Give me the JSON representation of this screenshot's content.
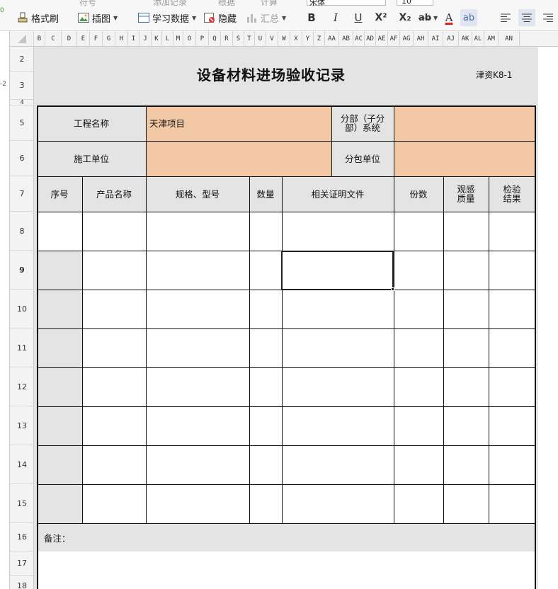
{
  "toolbar": {
    "partial_top": {
      "symbol": "符号",
      "records": "添加记录",
      "root": "根据",
      "calc": "计算"
    },
    "format_painter": "格式刷",
    "insert_image": "插图",
    "learn_data": "学习数据",
    "hide": "隐藏",
    "summary": "汇总",
    "font_name": "宋体",
    "font_size": "10",
    "bold": "B",
    "italic": "I",
    "underline": "U",
    "superscript": "X²",
    "subscript": "X₂",
    "strikethrough": "ab",
    "font_color": "A",
    "phonetic": "ab"
  },
  "columns": [
    "B",
    "C",
    "D",
    "E",
    "F",
    "G",
    "H",
    "I",
    "J",
    "K",
    "L",
    "M",
    "O",
    "P",
    "Q",
    "R",
    "S",
    "T",
    "U",
    "V",
    "W",
    "X",
    "Y",
    "Z",
    "AA",
    "AB",
    "AC",
    "AD",
    "AE",
    "AF",
    "AG",
    "AH",
    "AI",
    "AJ",
    "AK",
    "AL",
    "AM",
    "AN"
  ],
  "rows": [
    "2",
    "3",
    "4",
    "5",
    "6",
    "7",
    "8",
    "9",
    "10",
    "11",
    "12",
    "13",
    "14",
    "15",
    "16",
    "17",
    "18"
  ],
  "left_fragments": [
    "0",
    "-2"
  ],
  "form": {
    "title": "设备材料进场验收记录",
    "code": "津资K8-1",
    "project_label": "工程名称",
    "project_value": "天津项目",
    "sub_label": "分部（子分部）系统",
    "sub_value": "",
    "contractor_label": "施工单位",
    "contractor_value": "",
    "subcontractor_label": "分包单位",
    "subcontractor_value": "",
    "headers": {
      "seq": "序号",
      "product": "产品名称",
      "spec": "规格、型号",
      "qty": "数量",
      "certificate": "相关证明文件",
      "copies": "份数",
      "appearance": "观感质量",
      "result": "检验结果"
    },
    "remarks_label": "备注："
  },
  "colors": {
    "header_grey": "#e4e4e4",
    "input_peach": "#f2c9a4",
    "selection_border": "#222222"
  }
}
